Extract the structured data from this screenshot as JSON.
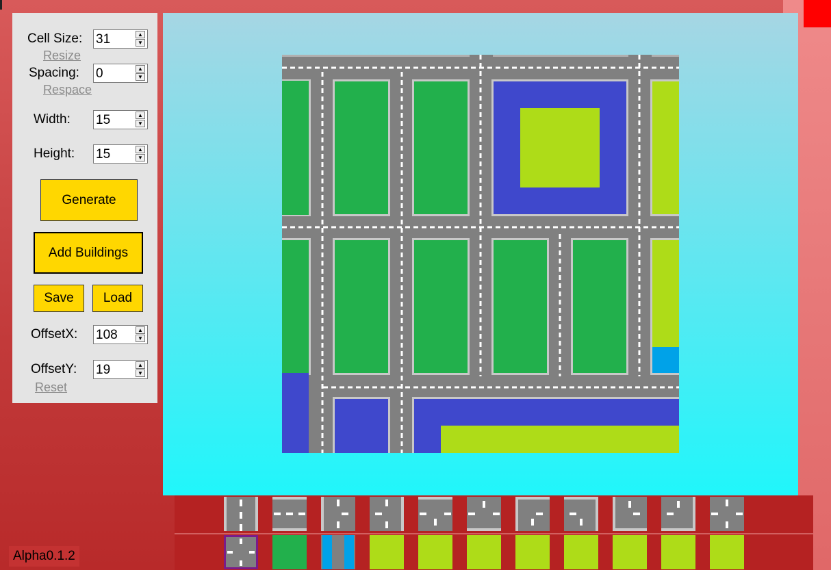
{
  "controls": {
    "cell_size_label": "Cell Size:",
    "cell_size_value": "31",
    "resize_link": "Resize",
    "spacing_label": "Spacing:",
    "spacing_value": "0",
    "respace_link": "Respace",
    "width_label": "Width:",
    "width_value": "15",
    "height_label": "Height:",
    "height_value": "15",
    "generate_label": "Generate",
    "add_buildings_label": "Add Buildings",
    "save_label": "Save",
    "load_label": "Load",
    "offset_x_label": "OffsetX:",
    "offset_x_value": "108",
    "offset_y_label": "OffsetY:",
    "offset_y_value": "19",
    "reset_link": "Reset",
    "spin_up_glyph": "▲",
    "spin_down_glyph": "▼"
  },
  "colors": {
    "road": "#808080",
    "road_marking": "#ffffff",
    "building_green": "#22b04c",
    "water_blue": "#3f48cc",
    "grass": "#aedc18",
    "accent_yellow": "#ffd700",
    "selected_tile_border": "#7a1b8a"
  },
  "palette": {
    "road_tile_icons": [
      "road-vertical-icon",
      "road-horizontal-icon",
      "road-t-east-icon",
      "road-t-west-icon",
      "road-t-south-icon",
      "road-t-north-icon",
      "road-corner-se-icon",
      "road-corner-sw-icon",
      "road-corner-ne-icon",
      "road-corner-nw-icon",
      "road-cross-icon"
    ],
    "ground_tile_icons": [
      "road-cross-icon",
      "building-tile-icon",
      "water-tile-icon",
      "grass-tile-icon",
      "grass-tile-icon",
      "grass-tile-icon",
      "grass-tile-icon",
      "grass-tile-icon",
      "grass-tile-icon",
      "grass-tile-icon",
      "grass-tile-icon"
    ]
  },
  "version": "Alpha0.1.2"
}
